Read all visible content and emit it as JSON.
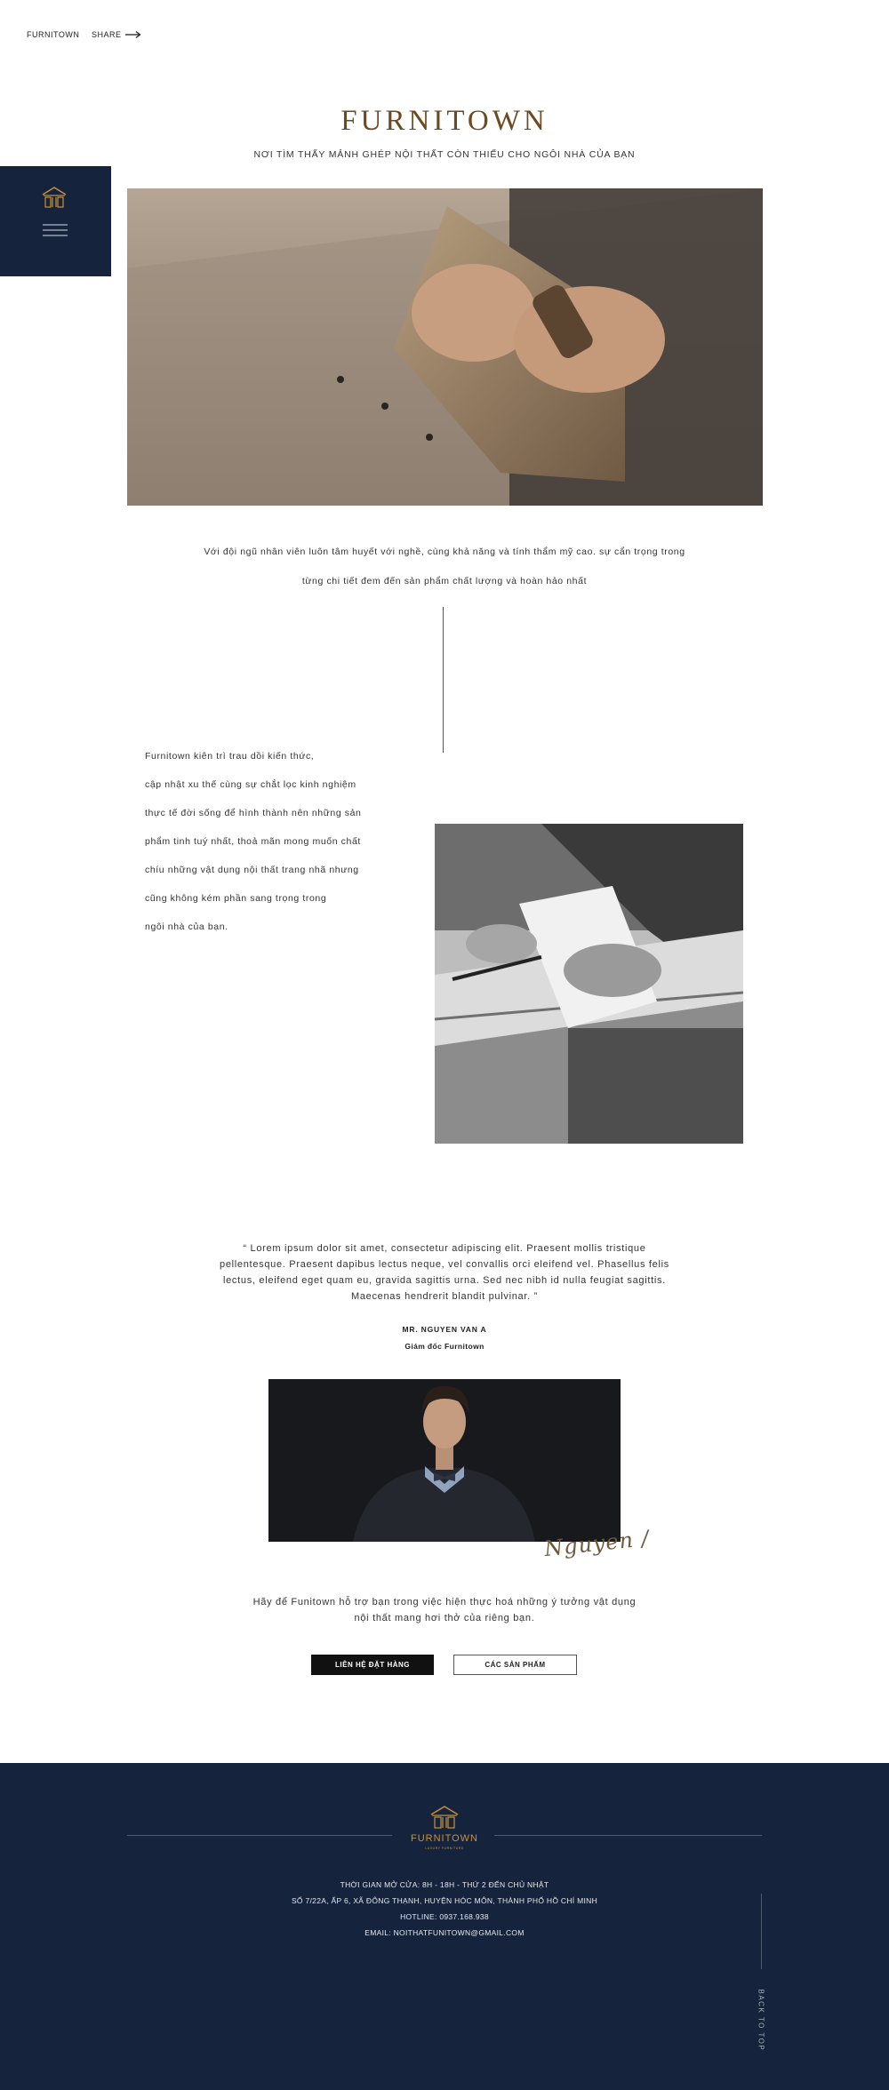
{
  "header": {
    "brand": "FURNITOWN",
    "share_label": "SHARE"
  },
  "hero": {
    "title": "FURNITOWN",
    "tagline": "NƠI TÌM THẤY MẢNH GHÉP NỘI THẤT CÒN THIẾU CHO NGÔI NHÀ CỦA BẠN"
  },
  "intro": {
    "lines": [
      "Với đội ngũ nhân viên luôn tâm huyết với nghề, cùng khả năng và tính thẩm mỹ cao. sự cẩn trọng trong",
      "từng chi tiết đem đến sản phẩm chất lượng và hoàn hảo nhất"
    ]
  },
  "story": {
    "lines": [
      "Furnitown kiên trì trau dồi kiến thức,",
      "cập nhật xu thế cùng sự chắt lọc kinh nghiệm",
      "thực tế đời sống để hình thành nên những sản",
      "phẩm tinh tuý nhất, thoả mãn mong muốn chất",
      "chíu những vật dụng nội thất trang nhã nhưng",
      "cũng không kém phần sang trọng trong",
      "ngôi nhà của bạn."
    ]
  },
  "quote": {
    "lines": [
      "“ Lorem ipsum dolor sit amet, consectetur adipiscing elit. Praesent mollis tristique",
      "pellentesque. Praesent dapibus lectus neque, vel convallis orci eleifend vel. Phasellus felis",
      "lectus, eleifend eget quam eu, gravida sagittis urna. Sed nec nibh id nulla feugiat sagittis.",
      "Maecenas hendrerit blandit pulvinar. ”"
    ],
    "author_name": "MR. NGUYEN VAN A",
    "author_role": "Giám đốc Furnitown",
    "signature": "Nguyen /"
  },
  "cta": {
    "lines": [
      "Hãy để Funitown hỗ trợ bạn trong việc hiện thực hoá những ý tưởng vật dụng",
      "nội thất mang hơi thở của riêng bạn."
    ],
    "order_button": "LIÊN HỆ ĐẶT HÀNG",
    "products_button": "CÁC SẢN PHẨM"
  },
  "footer": {
    "brand": "FURNITOWN",
    "brand_sub": "LUXURY FURNITURE",
    "hours": "THỜI GIAN MỞ CỬA: 8H - 18H  - THỨ 2 ĐẾN CHỦ NHẬT",
    "address": "SỐ 7/22A, ẤP 6, XÃ ĐÔNG THẠNH, HUYỆN HÓC MÔN, THÀNH PHỐ HỒ CHÍ MINH",
    "hotline": "HOTLINE: 0937.168.938",
    "email": "EMAIL: NOITHATFUNITOWN@GMAIL.COM",
    "back_to_top": "BACK TO TOP"
  },
  "colors": {
    "navy": "#15233d",
    "gold": "#c8923a",
    "brown_title": "#6b4a20"
  }
}
